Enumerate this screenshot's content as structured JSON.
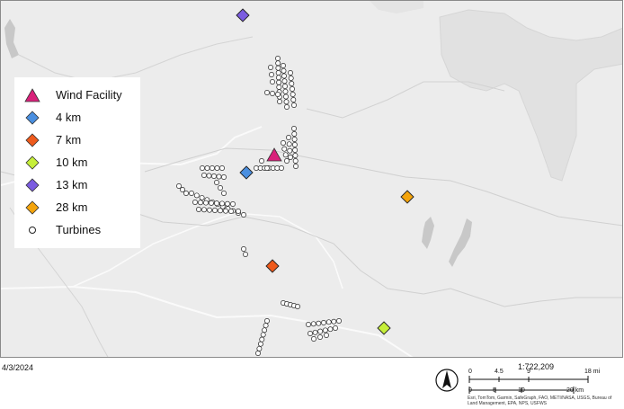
{
  "map": {
    "title": "",
    "date": "4/3/2024",
    "scale_ratio": "1:722,209",
    "scale_mi_ticks": [
      "0",
      "4.5",
      "9",
      "18 mi"
    ],
    "scale_km_ticks": [
      "0",
      "5",
      "10",
      "20 km"
    ],
    "attribution": "Esri, TomTom, Garmin, SafeGraph, FAO, METI/NASA, USGS, Bureau of Land Management, EPA, NPS, USFWS",
    "north_arrow": "north-arrow-icon"
  },
  "legend": {
    "items": [
      {
        "label": "Wind Facility",
        "symbol": "triangle",
        "color": "#d9207a"
      },
      {
        "label": "4 km",
        "symbol": "diamond",
        "color": "#4a8fe0"
      },
      {
        "label": "7 km",
        "symbol": "diamond",
        "color": "#ee5a1c"
      },
      {
        "label": "10 km",
        "symbol": "diamond",
        "color": "#c6ef3a"
      },
      {
        "label": "13 km",
        "symbol": "diamond",
        "color": "#7b5ce0"
      },
      {
        "label": "28 km",
        "symbol": "diamond",
        "color": "#f4a40c"
      },
      {
        "label": "Turbines",
        "symbol": "circle",
        "color": "#ffffff"
      }
    ]
  },
  "colors": {
    "background": "#ececec",
    "public_land": "#e1e1e1",
    "water": "#c8c8c8",
    "boundary": "#ffffff"
  }
}
